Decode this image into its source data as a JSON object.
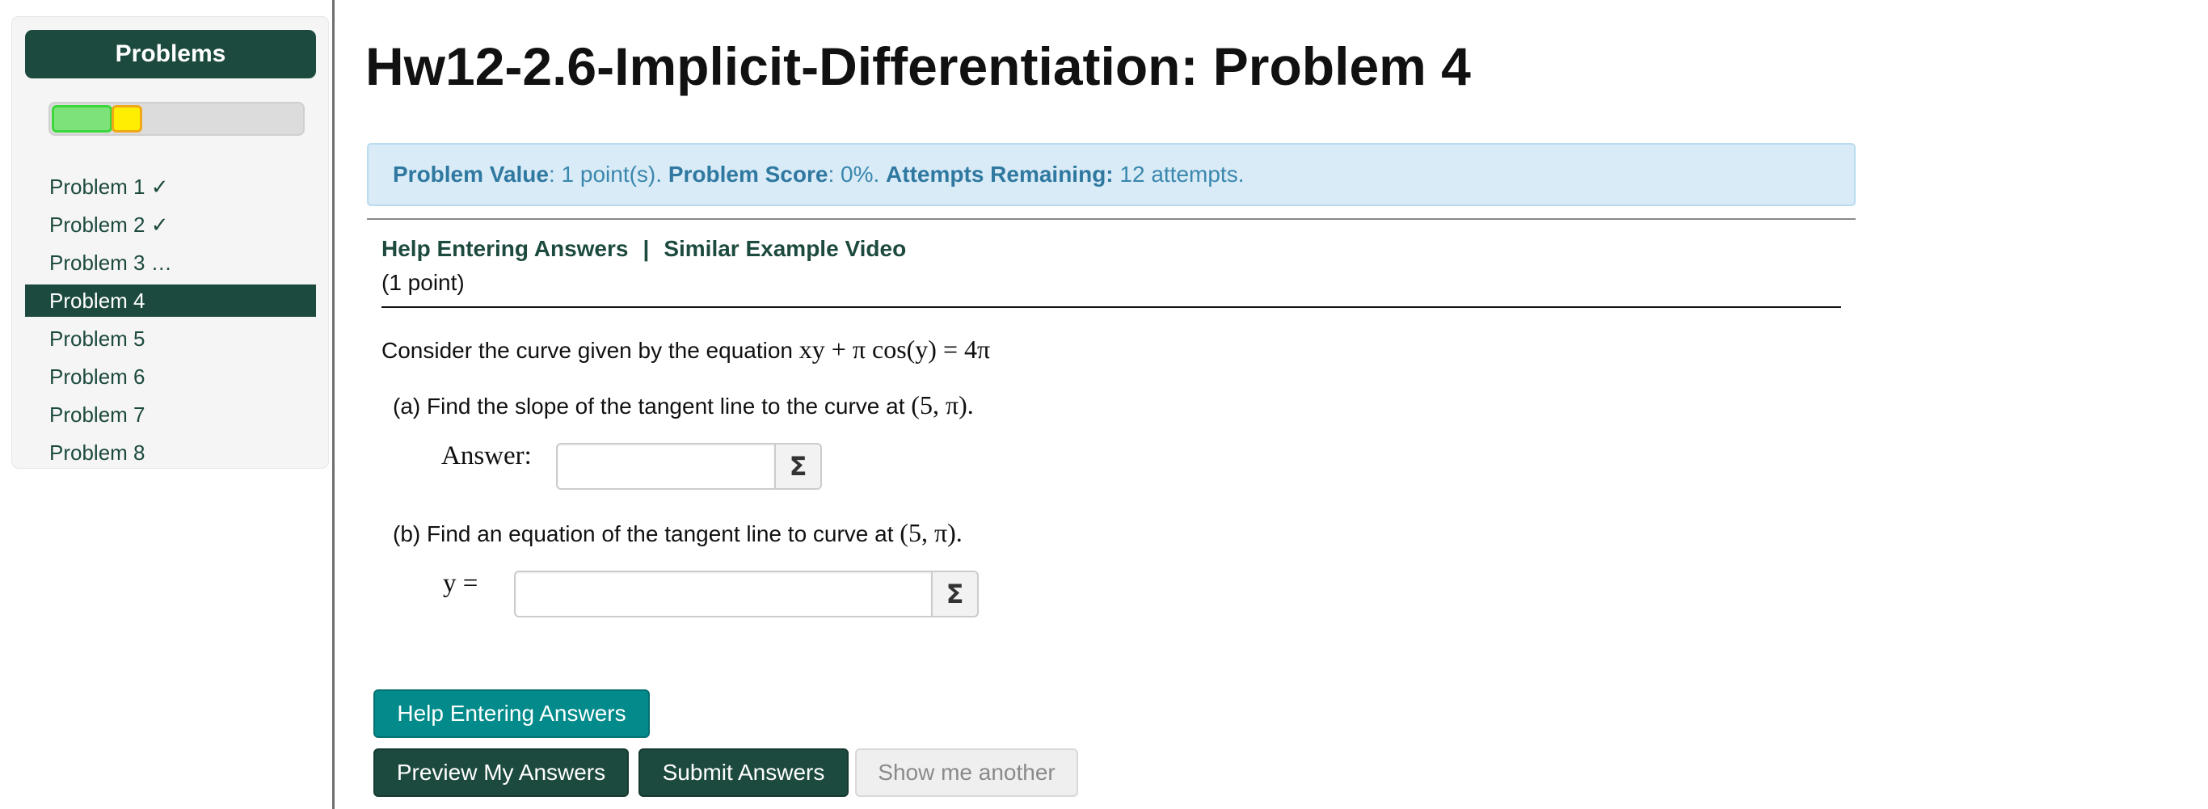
{
  "sidebar": {
    "header": "Problems",
    "progress": {
      "green_fraction": 0.14,
      "yellow_fraction": 0.07
    },
    "items": [
      {
        "label": "Problem 1 ✓",
        "active": false
      },
      {
        "label": "Problem 2 ✓",
        "active": false
      },
      {
        "label": "Problem 3 …",
        "active": false
      },
      {
        "label": "Problem 4",
        "active": true
      },
      {
        "label": "Problem 5",
        "active": false
      },
      {
        "label": "Problem 6",
        "active": false
      },
      {
        "label": "Problem 7",
        "active": false
      },
      {
        "label": "Problem 8",
        "active": false
      }
    ]
  },
  "main": {
    "title": "Hw12-2.6-Implicit-Differentiation: Problem 4",
    "info": {
      "value_label": "Problem Value",
      "value_text": ": 1 point(s). ",
      "score_label": "Problem Score",
      "score_text": ": 0%. ",
      "attempts_label": "Attempts Remaining:",
      "attempts_text": " 12 attempts."
    },
    "links": {
      "help": "Help Entering Answers",
      "separator": "|",
      "video": "Similar Example Video"
    },
    "points": "(1 point)",
    "statement": "Consider the curve given by the equation ",
    "equation": "xy + π cos(y) = 4π",
    "part_a": "(a) Find the slope of the tangent line to the curve at ",
    "part_a_point": "(5, π).",
    "answer_a_label": "Answer:",
    "part_b": "(b) Find an equation of the tangent line to curve at ",
    "part_b_point": "(5, π).",
    "answer_b_label": "y =",
    "sigma": "Σ",
    "buttons": {
      "help": "Help Entering Answers",
      "preview": "Preview My Answers",
      "submit": "Submit Answers",
      "another": "Show me another"
    }
  },
  "colors": {
    "brand_dark": "#1d4a3e",
    "teal": "#038a8a",
    "info_bg": "#d9ebf7",
    "info_text": "#3a87ad",
    "progress_green": "#7de27a",
    "progress_yellow": "#ffee00"
  }
}
